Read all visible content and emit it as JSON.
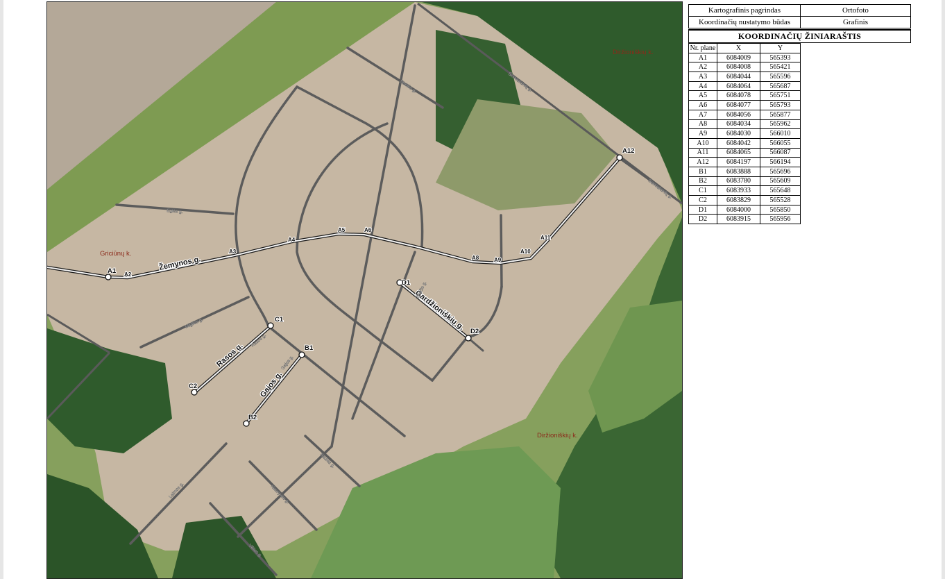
{
  "info_table": {
    "rows": [
      {
        "label": "Kartografinis pagrindas",
        "value": "Ortofoto"
      },
      {
        "label": "Koordinačių nustatymo būdas",
        "value": "Grafinis"
      }
    ],
    "title": "KOORDINAČIŲ ŽINIARAŠTIS",
    "columns": [
      "Nr. plane",
      "X",
      "Y"
    ],
    "points": [
      {
        "id": "A1",
        "x": "6084009",
        "y": "565393"
      },
      {
        "id": "A2",
        "x": "6084008",
        "y": "565421"
      },
      {
        "id": "A3",
        "x": "6084044",
        "y": "565596"
      },
      {
        "id": "A4",
        "x": "6084064",
        "y": "565687"
      },
      {
        "id": "A5",
        "x": "6084078",
        "y": "565751"
      },
      {
        "id": "A6",
        "x": "6084077",
        "y": "565793"
      },
      {
        "id": "A7",
        "x": "6084056",
        "y": "565877"
      },
      {
        "id": "A8",
        "x": "6084034",
        "y": "565962"
      },
      {
        "id": "A9",
        "x": "6084030",
        "y": "566010"
      },
      {
        "id": "A10",
        "x": "6084042",
        "y": "566055"
      },
      {
        "id": "A11",
        "x": "6084065",
        "y": "566087"
      },
      {
        "id": "A12",
        "x": "6084197",
        "y": "566194"
      },
      {
        "id": "B1",
        "x": "6083888",
        "y": "565696"
      },
      {
        "id": "B2",
        "x": "6083780",
        "y": "565609"
      },
      {
        "id": "C1",
        "x": "6083933",
        "y": "565648"
      },
      {
        "id": "C2",
        "x": "6083829",
        "y": "565528"
      },
      {
        "id": "D1",
        "x": "6084000",
        "y": "565850"
      },
      {
        "id": "D2",
        "x": "6083915",
        "y": "565956"
      }
    ]
  },
  "map": {
    "village_labels": [
      "Griciūnų k.",
      "Diržioniškių k.",
      "Diržioniškių k."
    ],
    "street_labels": {
      "zemynos": "Žemynos g.",
      "gardzioniskiu": "Gardžioniškių g.",
      "rasos": "Rasos g.",
      "gajos": "Gajos g."
    },
    "minor_labels": [
      "Eglės g.",
      "Migllės g.",
      "Rasos g.",
      "Gajos g.",
      "Saulės g.",
      "Strėlės g.",
      "Šermukšnių g.",
      "Laimos g.",
      "Nauryvės g.",
      "Vilties g.",
      "Žilvičio g.",
      "Šermukšnių g."
    ],
    "point_labels": {
      "A1": "A1",
      "A2": "A2",
      "A3": "A3",
      "A4": "A4",
      "A5": "A5",
      "A6": "A6",
      "A8": "A8",
      "A9": "A9",
      "A10": "A10",
      "A11": "A11",
      "A12": "A12",
      "B1": "B1",
      "B2": "B2",
      "C1": "C1",
      "C2": "C2",
      "D1": "D1",
      "D2": "D2"
    },
    "colors": {
      "field": "#c3b39f",
      "forest": "#2e5a2a",
      "meadow": "#7b9a55",
      "road": "#555555",
      "route": "#ffffff",
      "label": "#8b2a1a"
    }
  }
}
